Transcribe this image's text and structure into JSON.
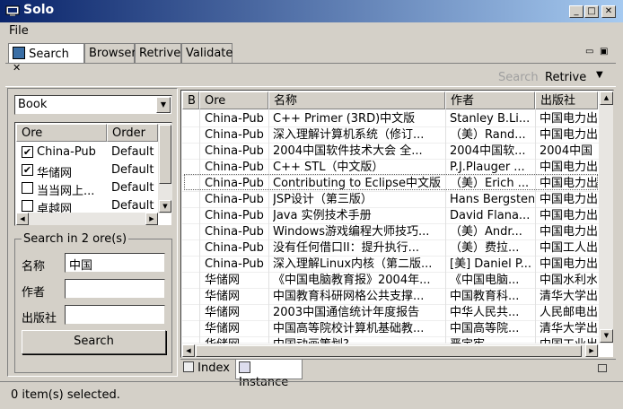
{
  "window": {
    "title": "Solo",
    "minimize": "_",
    "maximize": "□",
    "close": "✕"
  },
  "menu": {
    "file": "File"
  },
  "tabs": [
    {
      "label": "Search",
      "close": "✕"
    },
    {
      "label": "Browser"
    },
    {
      "label": "Retrive"
    },
    {
      "label": "Validate"
    }
  ],
  "view_toolbar": {
    "search": "Search",
    "retrive": "Retrive",
    "menu": "▼",
    "minimize": "▭",
    "restore": "▣"
  },
  "left": {
    "source_select": "Book",
    "ore_table": {
      "headers": [
        "Ore",
        "Order"
      ],
      "rows": [
        {
          "checked": true,
          "name": "China-Pub",
          "order": "Default"
        },
        {
          "checked": true,
          "name": "华储网",
          "order": "Default"
        },
        {
          "checked": false,
          "name": "当当网上...",
          "order": "Default"
        },
        {
          "checked": false,
          "name": "卓越网",
          "order": "Default"
        }
      ]
    },
    "search_group": {
      "title": "Search in 2 ore(s)",
      "name_label": "名称",
      "name_value": "中国",
      "author_label": "作者",
      "author_value": "",
      "publisher_label": "出版社",
      "publisher_value": "",
      "button": "Search"
    }
  },
  "results": {
    "headers": [
      "B",
      "Ore",
      "名称",
      "作者",
      "出版社"
    ],
    "rows": [
      [
        "China-Pub",
        "C++ Primer (3RD)中文版",
        "Stanley B.Li...",
        "中国电力出"
      ],
      [
        "China-Pub",
        "深入理解计算机系统（修订...",
        "（美）Rand...",
        "中国电力出"
      ],
      [
        "China-Pub",
        "2004中国软件技术大会 全...",
        "2004中国软...",
        "2004中国"
      ],
      [
        "China-Pub",
        "C++ STL（中文版）",
        "P.J.Plauger ...",
        "中国电力出"
      ],
      [
        "China-Pub",
        "Contributing to Eclipse中文版",
        "（美）Erich ...",
        "中国电力出"
      ],
      [
        "China-Pub",
        "JSP设计（第三版）",
        "Hans Bergsten",
        "中国电力出"
      ],
      [
        "China-Pub",
        "Java 实例技术手册",
        "David Flana...",
        "中国电力出"
      ],
      [
        "China-Pub",
        "Windows游戏编程大师技巧...",
        "（美）Andr...",
        "中国电力出"
      ],
      [
        "China-Pub",
        "没有任何借口II：提升执行...",
        "（美）费拉...",
        "中国工人出"
      ],
      [
        "China-Pub",
        "深入理解Linux内核（第二版...",
        "[美] Daniel P...",
        "中国电力出"
      ],
      [
        "华储网",
        "《中国电脑教育报》2004年...",
        "《中国电脑...",
        "中国水利水"
      ],
      [
        "华储网",
        "中国教育科研网格公共支撑...",
        "中国教育科...",
        "清华大学出"
      ],
      [
        "华储网",
        "2003中国通信统计年度报告",
        "中华人民共...",
        "人民邮电出"
      ],
      [
        "华储网",
        "中国高等院校计算机基础教...",
        "中国高等院...",
        "清华大学出"
      ],
      [
        "华储网",
        "中国动画策划?",
        "严定宪",
        "中国工业出"
      ]
    ]
  },
  "bottom_tabs": [
    {
      "label": "Index"
    },
    {
      "label": "Instance"
    }
  ],
  "status": "0 item(s) selected."
}
